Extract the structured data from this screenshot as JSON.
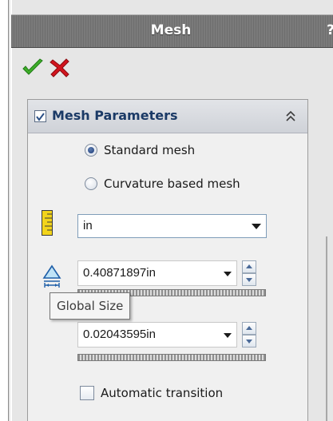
{
  "window": {
    "title": "Mesh",
    "help_glyph": "?"
  },
  "actions": {
    "ok_icon": "checkmark-icon",
    "cancel_icon": "x-icon"
  },
  "group": {
    "title": "Mesh Parameters",
    "checked": true
  },
  "mesh_type": {
    "options": [
      "Standard mesh",
      "Curvature based mesh"
    ],
    "selected": "Standard mesh"
  },
  "units": {
    "value": "in"
  },
  "global_size": {
    "value": "0.40871897in",
    "tooltip": "Global Size"
  },
  "tolerance": {
    "value": "0.02043595in"
  },
  "auto_transition": {
    "label": "Automatic transition",
    "checked": false
  },
  "colors": {
    "title_bar": "#717171",
    "accent_green": "#3fae2a",
    "accent_red": "#d2141e",
    "group_title": "#1b3a66"
  }
}
